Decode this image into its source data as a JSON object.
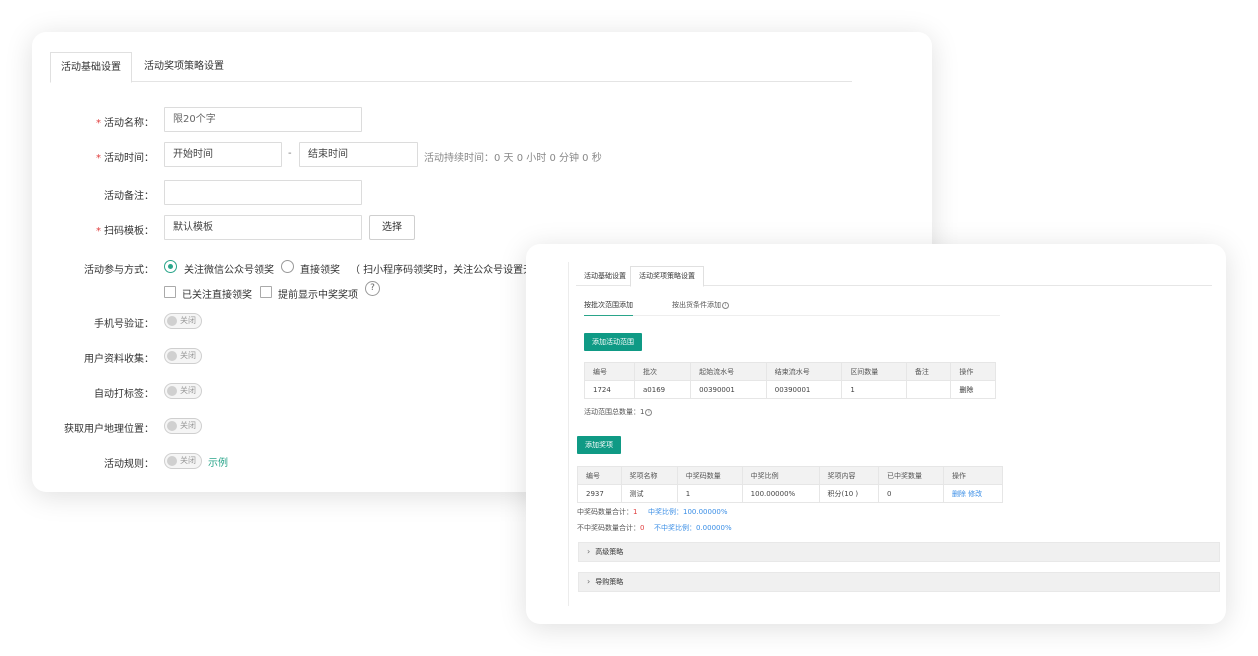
{
  "basic": {
    "tabs": [
      {
        "label": "活动基础设置"
      },
      {
        "label": "活动奖项策略设置"
      }
    ],
    "name": {
      "label": "活动名称：",
      "placeholder": "限20个字"
    },
    "time": {
      "label": "活动时间：",
      "start": "开始时间",
      "separator": "-",
      "end": "结束时间",
      "duration": "活动持续时间：0 天 0 小时 0 分钟 0 秒"
    },
    "remark": {
      "label": "活动备注：",
      "value": ""
    },
    "template": {
      "label": "扫码模板：",
      "value": "默认模板",
      "button": "选择"
    },
    "participation": {
      "label": "活动参与方式：",
      "option1": "关注微信公众号领奖",
      "option2": "直接领奖",
      "note": "（ 扫小程序码领奖时，关注公众号设置无效",
      "check1": "已关注直接领奖",
      "check2": "提前显示中奖奖项",
      "help": "?"
    },
    "toggles": [
      {
        "label": "手机号验证：",
        "state": "关闭"
      },
      {
        "label": "用户资料收集：",
        "state": "关闭"
      },
      {
        "label": "自动打标签：",
        "state": "关闭"
      },
      {
        "label": "获取用户地理位置：",
        "state": "关闭"
      },
      {
        "label": "活动规则：",
        "state": "关闭"
      }
    ],
    "rules_link": "示例",
    "required_mark": "*"
  },
  "strategy": {
    "tabs": [
      {
        "label": "活动基础设置"
      },
      {
        "label": "活动奖项策略设置"
      }
    ],
    "subtabs": [
      {
        "label": "按批次范围添加"
      },
      {
        "label": "按出货条件添加"
      }
    ],
    "add_range_button": "添加活动范围",
    "range_table": {
      "headers": [
        "编号",
        "批次",
        "起始流水号",
        "结束流水号",
        "区间数量",
        "备注",
        "操作"
      ],
      "rows": [
        [
          "1724",
          "a0169",
          "00390001",
          "00390001",
          "1",
          "",
          "删除"
        ]
      ]
    },
    "range_total": "活动范围总数量：1",
    "add_prize_button": "添加奖项",
    "prize_table": {
      "headers": [
        "编号",
        "奖项名称",
        "中奖码数量",
        "中奖比例",
        "奖项内容",
        "已中奖数量",
        "操作"
      ],
      "rows": [
        [
          "2937",
          "测试",
          "1",
          "100.00000%",
          "积分(10 )",
          "0",
          "删除",
          "修改"
        ]
      ]
    },
    "win_total_label": "中奖码数量合计：",
    "win_total_value": "1",
    "win_ratio": "中奖比例：100.00000%",
    "lose_total_label": "不中奖码数量合计：",
    "lose_total_value": "0",
    "lose_ratio": "不中奖比例：0.00000%",
    "advanced": "高级策略",
    "guide": "导购策略"
  }
}
